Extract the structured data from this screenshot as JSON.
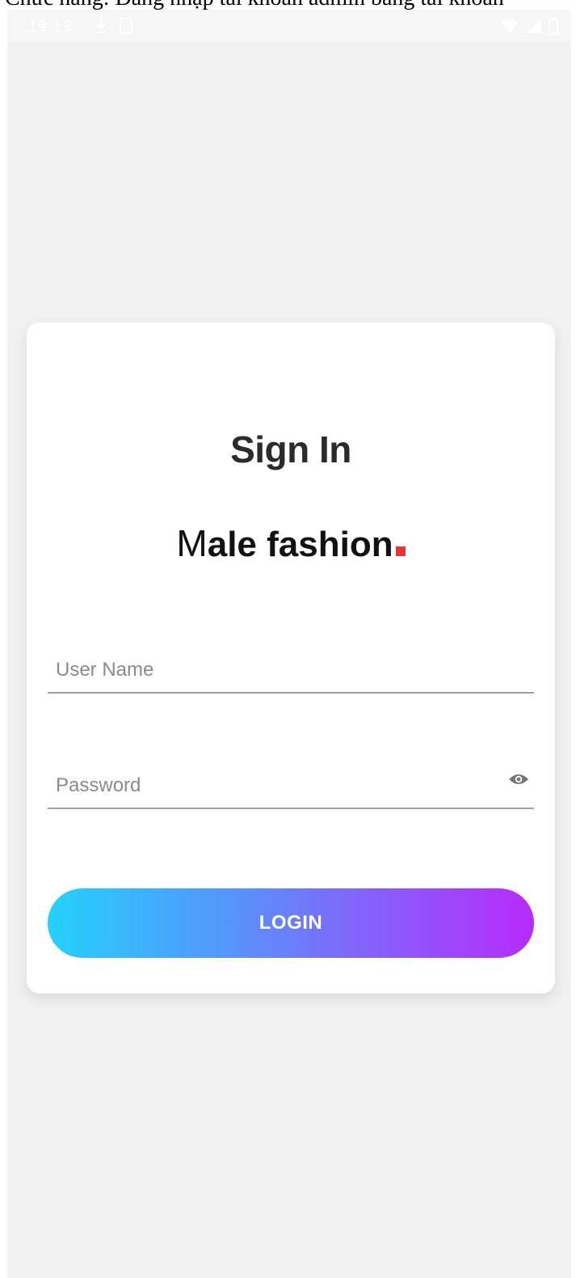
{
  "caption": "Chức năng: Đăng nhập tài khoản admin bằng tài khoản",
  "status_bar": {
    "time": "19:19"
  },
  "card": {
    "title": "Sign In",
    "logo": {
      "first_letter": "M",
      "rest": "ale fashion",
      "dot_color": "#e53637"
    },
    "username": {
      "placeholder": "User Name",
      "value": ""
    },
    "password": {
      "placeholder": "Password",
      "value": ""
    },
    "login_label": "LOGIN"
  },
  "colors": {
    "background": "#f1f1f1",
    "card": "#ffffff",
    "gradient_start": "#24d1fb",
    "gradient_end": "#b72bfa"
  },
  "icons": {
    "status_left": [
      "download-icon",
      "sim-card-icon"
    ],
    "status_right": [
      "wifi-icon",
      "signal-icon",
      "battery-icon"
    ],
    "password_toggle": "eye-icon"
  }
}
